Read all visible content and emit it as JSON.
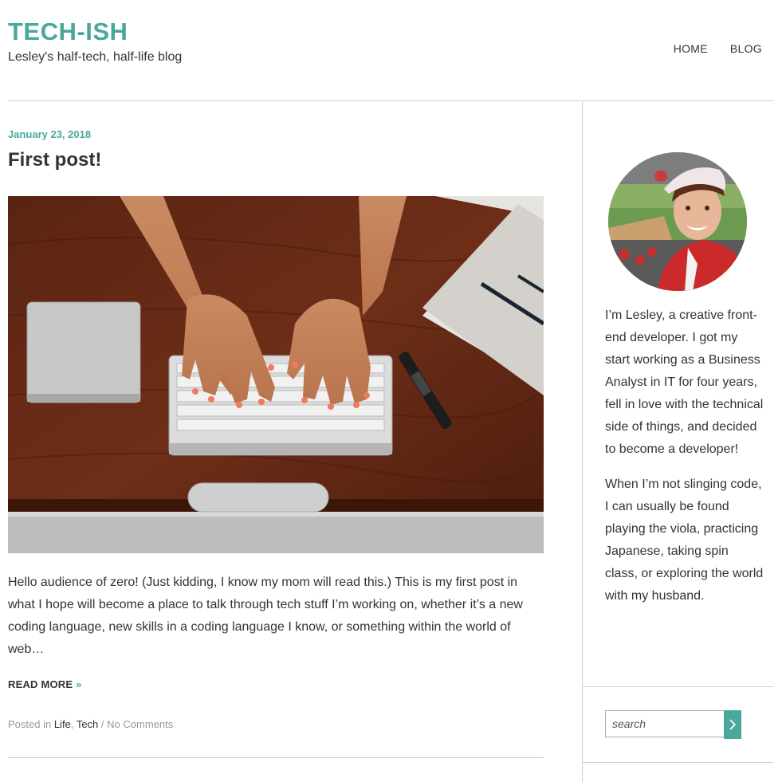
{
  "site": {
    "title": "TECH-ISH",
    "tagline": "Lesley's half-tech, half-life blog",
    "accent_color": "#4aa89a"
  },
  "nav": {
    "items": [
      {
        "label": "HOME"
      },
      {
        "label": "BLOG"
      }
    ]
  },
  "post": {
    "date": "January 23, 2018",
    "title": "First post!",
    "image_icon": "photo-hands-typing-on-keyboard",
    "excerpt": "Hello audience of zero! (Just kidding, I know my mom will read this.) This is my first post in what I hope will become a place to talk through tech stuff I’m working on, whether it’s a new coding language, new skills in a coding language I know, or something within the world of web…",
    "read_more": "READ MORE",
    "read_more_arrow": "»",
    "meta": {
      "posted_in": "Posted in",
      "categories": [
        "Life",
        "Tech"
      ],
      "separator": ",",
      "slash": "/",
      "comments": "No Comments"
    }
  },
  "sidebar": {
    "avatar_icon": "avatar-photo",
    "bio": [
      "I’m Lesley, a creative front-end developer. I got my start working as a Business Analyst in IT for four years, fell in love with the technical side of things, and decided to become a developer!",
      "When I’m not slinging code, I can usually be found playing the viola, practicing Japanese, taking spin class, or exploring the world with my husband."
    ],
    "search": {
      "placeholder": "search",
      "button_icon": "chevron-right-icon"
    }
  }
}
